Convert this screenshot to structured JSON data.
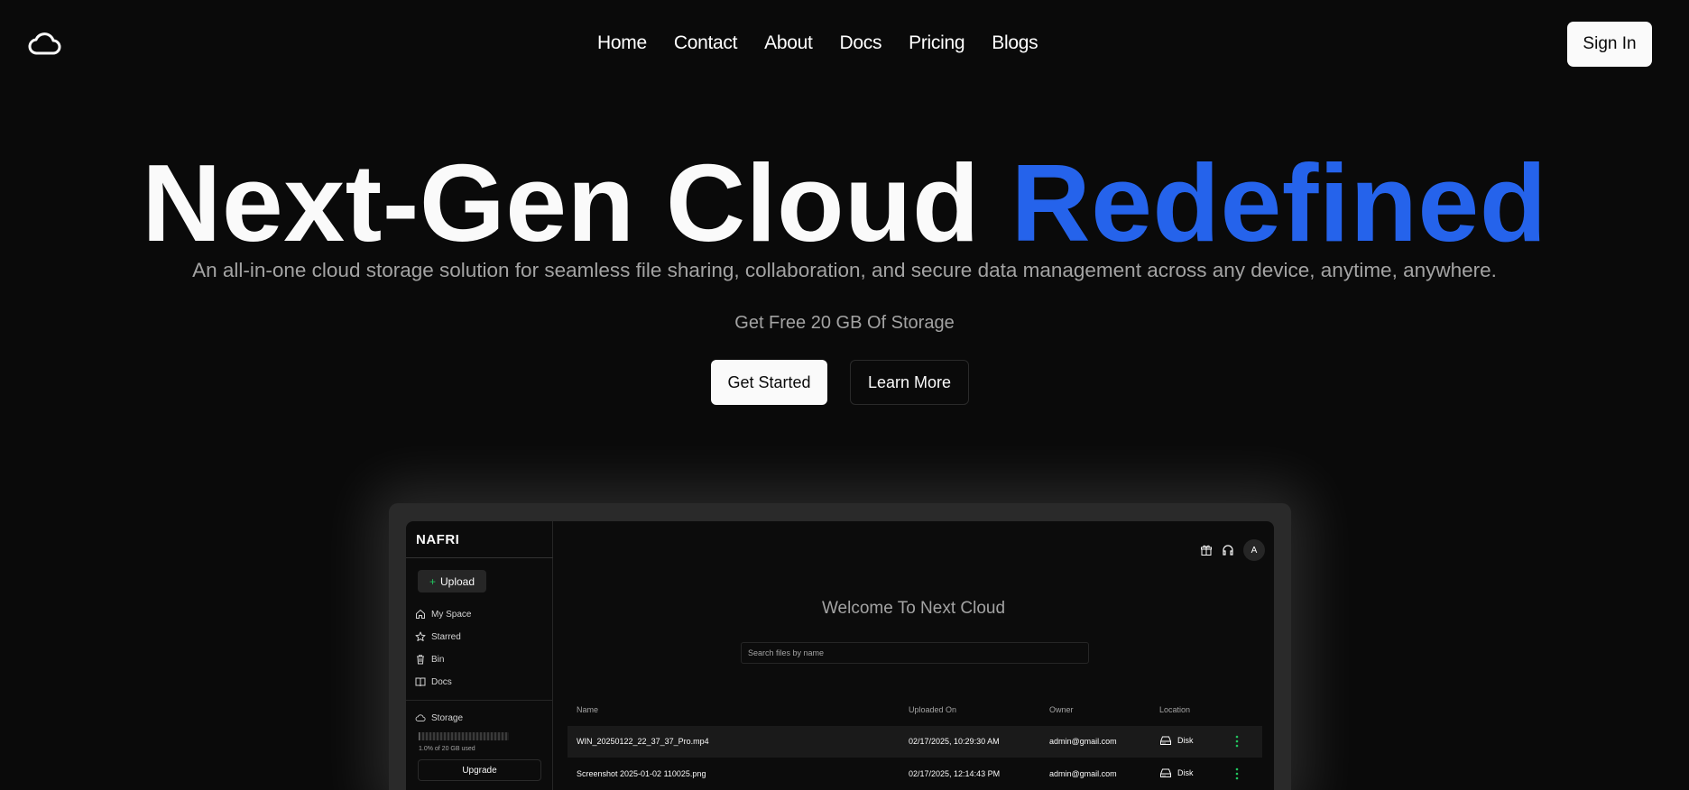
{
  "nav": {
    "logo_icon": "cloud-icon",
    "links": [
      "Home",
      "Contact",
      "About",
      "Docs",
      "Pricing",
      "Blogs"
    ],
    "signin_label": "Sign In"
  },
  "hero": {
    "title_main": "Next-Gen Cloud",
    "title_accent": "Redefined",
    "accent_color": "#2563eb",
    "subtitle": "An all-in-one cloud storage solution for seamless file sharing, collaboration, and secure data management across any device, anytime, anywhere.",
    "free_storage": "Get Free 20 GB Of Storage",
    "cta_primary": "Get Started",
    "cta_secondary": "Learn More"
  },
  "app": {
    "brand": "NAFRI",
    "upload_label": "Upload",
    "sidebar": [
      {
        "label": "My Space",
        "icon": "home-icon"
      },
      {
        "label": "Starred",
        "icon": "star-icon"
      },
      {
        "label": "Bin",
        "icon": "trash-icon"
      },
      {
        "label": "Docs",
        "icon": "book-icon"
      }
    ],
    "storage": {
      "label": "Storage",
      "icon": "cloud-icon",
      "used_fraction": 0.01,
      "usage_text": "1.0% of 20 GB used",
      "upgrade_label": "Upgrade"
    },
    "header_icons": [
      "gift-icon",
      "headset-icon"
    ],
    "avatar_letter": "A",
    "welcome": "Welcome To Next Cloud",
    "search_placeholder": "Search files by name",
    "table": {
      "columns": [
        "Name",
        "Uploaded On",
        "Owner",
        "Location"
      ],
      "rows": [
        {
          "name": "WIN_20250122_22_37_37_Pro.mp4",
          "uploaded": "02/17/2025, 10:29:30 AM",
          "owner": "admin@gmail.com",
          "location": "Disk"
        },
        {
          "name": "Screenshot 2025-01-02 110025.png",
          "uploaded": "02/17/2025, 12:14:43 PM",
          "owner": "admin@gmail.com",
          "location": "Disk"
        }
      ]
    }
  }
}
